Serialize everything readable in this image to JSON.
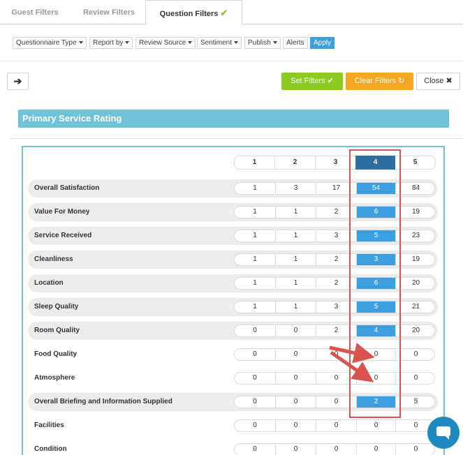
{
  "tabs": [
    {
      "label": "Guest Filters"
    },
    {
      "label": "Review Filters"
    },
    {
      "label": "Question Filters",
      "check": "✔"
    }
  ],
  "filters": [
    {
      "label": "Questionnaire Type"
    },
    {
      "label": "Report by"
    },
    {
      "label": "Review Source"
    },
    {
      "label": "Sentiment"
    },
    {
      "label": "Publish"
    },
    {
      "label": "Alerts"
    },
    {
      "label": "Apply"
    }
  ],
  "toolbar": {
    "arrow_icon": "➔",
    "set_filters": "Set Filters",
    "set_filters_icon": "✔",
    "clear_filters": "Clear Filters",
    "clear_filters_icon": "↻",
    "close": "Close",
    "close_icon": "✖"
  },
  "section": {
    "title": "Primary Service Rating"
  },
  "columns": [
    "1",
    "2",
    "3",
    "4",
    "5"
  ],
  "highlight_column": 4,
  "rows": [
    {
      "label": "Overall Satisfaction",
      "values": [
        "1",
        "3",
        "17",
        "54",
        "84"
      ],
      "shaded": true
    },
    {
      "label": "Value For Money",
      "values": [
        "1",
        "1",
        "2",
        "6",
        "19"
      ],
      "shaded": true
    },
    {
      "label": "Service Received",
      "values": [
        "1",
        "1",
        "3",
        "5",
        "23"
      ],
      "shaded": true
    },
    {
      "label": "Cleanliness",
      "values": [
        "1",
        "1",
        "2",
        "3",
        "19"
      ],
      "shaded": true
    },
    {
      "label": "Location",
      "values": [
        "1",
        "1",
        "2",
        "6",
        "20"
      ],
      "shaded": true
    },
    {
      "label": "Sleep Quality",
      "values": [
        "1",
        "1",
        "3",
        "5",
        "21"
      ],
      "shaded": true
    },
    {
      "label": "Room Quality",
      "values": [
        "0",
        "0",
        "2",
        "4",
        "20"
      ],
      "shaded": true
    },
    {
      "label": "Food Quality",
      "values": [
        "0",
        "0",
        "0",
        "0",
        "0"
      ],
      "shaded": false
    },
    {
      "label": "Atmosphere",
      "values": [
        "0",
        "0",
        "0",
        "0",
        "0"
      ],
      "shaded": false
    },
    {
      "label": "Overall Briefing and Information Supplied",
      "values": [
        "0",
        "0",
        "0",
        "2",
        "5"
      ],
      "shaded": true
    },
    {
      "label": "Facilities",
      "values": [
        "0",
        "0",
        "0",
        "0",
        "0"
      ],
      "shaded": false
    },
    {
      "label": "Condition",
      "values": [
        "0",
        "0",
        "0",
        "0",
        "0"
      ],
      "shaded": false
    }
  ],
  "colors": {
    "accent_blue": "#3d9ee0",
    "header_dark_blue": "#2f6f9f",
    "section_teal": "#70c2d6",
    "set_filters_green": "#8ccb1f",
    "clear_filters_orange": "#f5a623",
    "annotation_red": "#d9534f"
  },
  "chat_icon": "chat-bubble-icon"
}
